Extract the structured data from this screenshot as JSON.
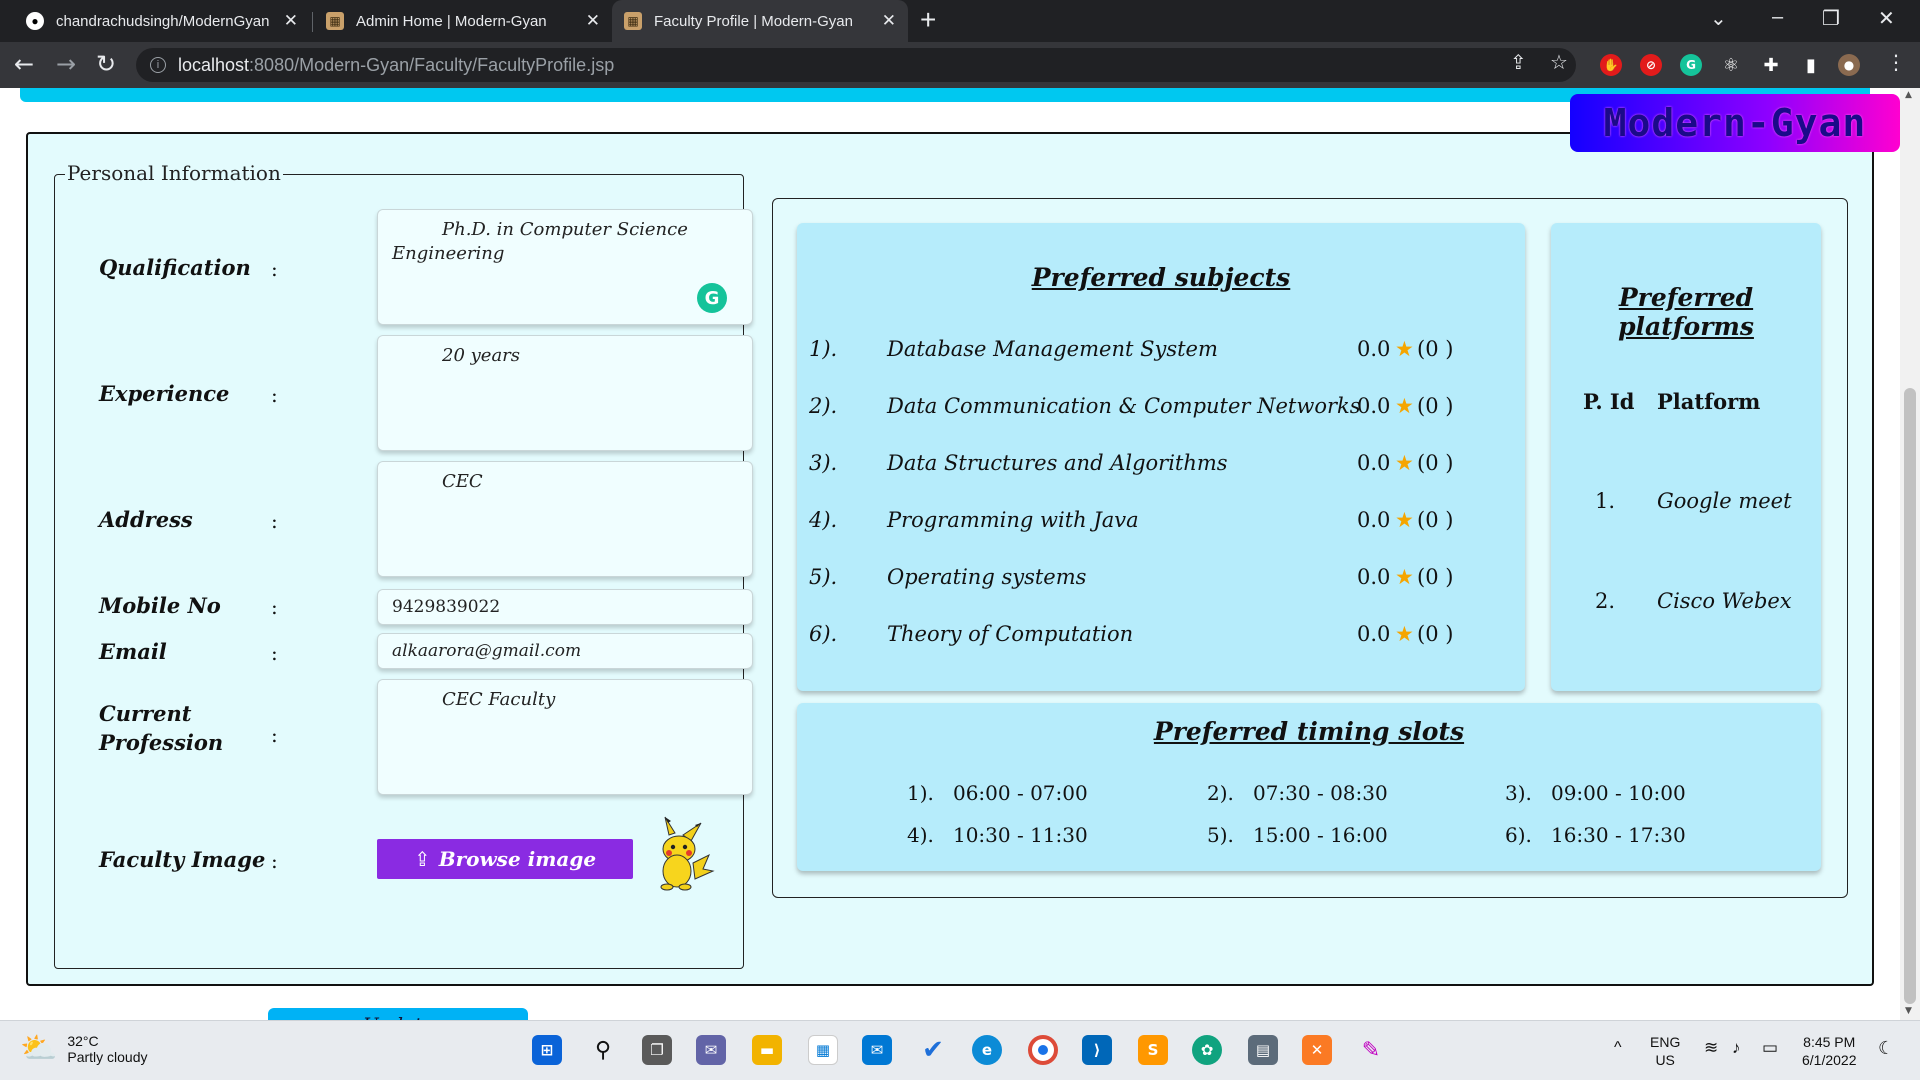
{
  "browser": {
    "tabs": [
      {
        "title": "chandrachudsingh/ModernGyan",
        "icon": "github-icon"
      },
      {
        "title": "Admin Home | Modern-Gyan",
        "icon": "site-favicon"
      },
      {
        "title": "Faculty Profile | Modern-Gyan",
        "icon": "site-favicon",
        "active": true
      }
    ],
    "new_tab": "+",
    "url_host": "localhost",
    "url_path": ":8080/Modern-Gyan/Faculty/FacultyProfile.jsp"
  },
  "brand": {
    "logo_text": "Modern-Gyan"
  },
  "personal": {
    "legend": "Personal Information",
    "colon": ":",
    "fields": {
      "qualification": {
        "label": "Qualification",
        "value": "Ph.D. in Computer Science Engineering"
      },
      "experience": {
        "label": "Experience",
        "value": "20 years"
      },
      "address": {
        "label": "Address",
        "value": "CEC"
      },
      "mobile": {
        "label": "Mobile No",
        "value": "9429839022"
      },
      "email": {
        "label": "Email",
        "value": "alkaarora@gmail.com"
      },
      "profession": {
        "label": "Current Profession",
        "value": "CEC Faculty"
      },
      "image": {
        "label": "Faculty Image",
        "button": "Browse image"
      }
    },
    "update_button": "Update"
  },
  "subjects": {
    "title": "Preferred subjects",
    "rows": [
      {
        "idx": "1).",
        "name": "Database Management System",
        "rating": "0.0",
        "count": "(0 )"
      },
      {
        "idx": "2).",
        "name": "Data Communication & Computer Networks",
        "rating": "0.0",
        "count": "(0 )"
      },
      {
        "idx": "3).",
        "name": "Data Structures and Algorithms",
        "rating": "0.0",
        "count": "(0 )"
      },
      {
        "idx": "4).",
        "name": "Programming with Java",
        "rating": "0.0",
        "count": "(0 )"
      },
      {
        "idx": "5).",
        "name": "Operating systems",
        "rating": "0.0",
        "count": "(0 )"
      },
      {
        "idx": "6).",
        "name": "Theory of Computation",
        "rating": "0.0",
        "count": "(0 )"
      }
    ]
  },
  "platforms": {
    "title": "Preferred platforms",
    "head_id": "P. Id",
    "head_name": "Platform",
    "rows": [
      {
        "id": "1.",
        "name": "Google meet"
      },
      {
        "id": "2.",
        "name": "Cisco Webex"
      }
    ]
  },
  "timings": {
    "title": "Preferred timing slots",
    "slots": [
      {
        "idx": "1).",
        "time": "06:00 - 07:00"
      },
      {
        "idx": "2).",
        "time": "07:30 - 08:30"
      },
      {
        "idx": "3).",
        "time": "09:00 - 10:00"
      },
      {
        "idx": "4).",
        "time": "10:30 - 11:30"
      },
      {
        "idx": "5).",
        "time": "15:00 - 16:00"
      },
      {
        "idx": "6).",
        "time": "16:30 - 17:30"
      }
    ]
  },
  "taskbar": {
    "temp": "32°C",
    "weather": "Partly cloudy",
    "lang": "ENG",
    "region": "US",
    "time": "8:45 PM",
    "date": "6/1/2022"
  },
  "colors": {
    "accent": "#00c8f0",
    "panel": "#b6ecfb",
    "card": "#e3fbfd",
    "browse": "#8a2be2",
    "update": "#00b2f5"
  }
}
